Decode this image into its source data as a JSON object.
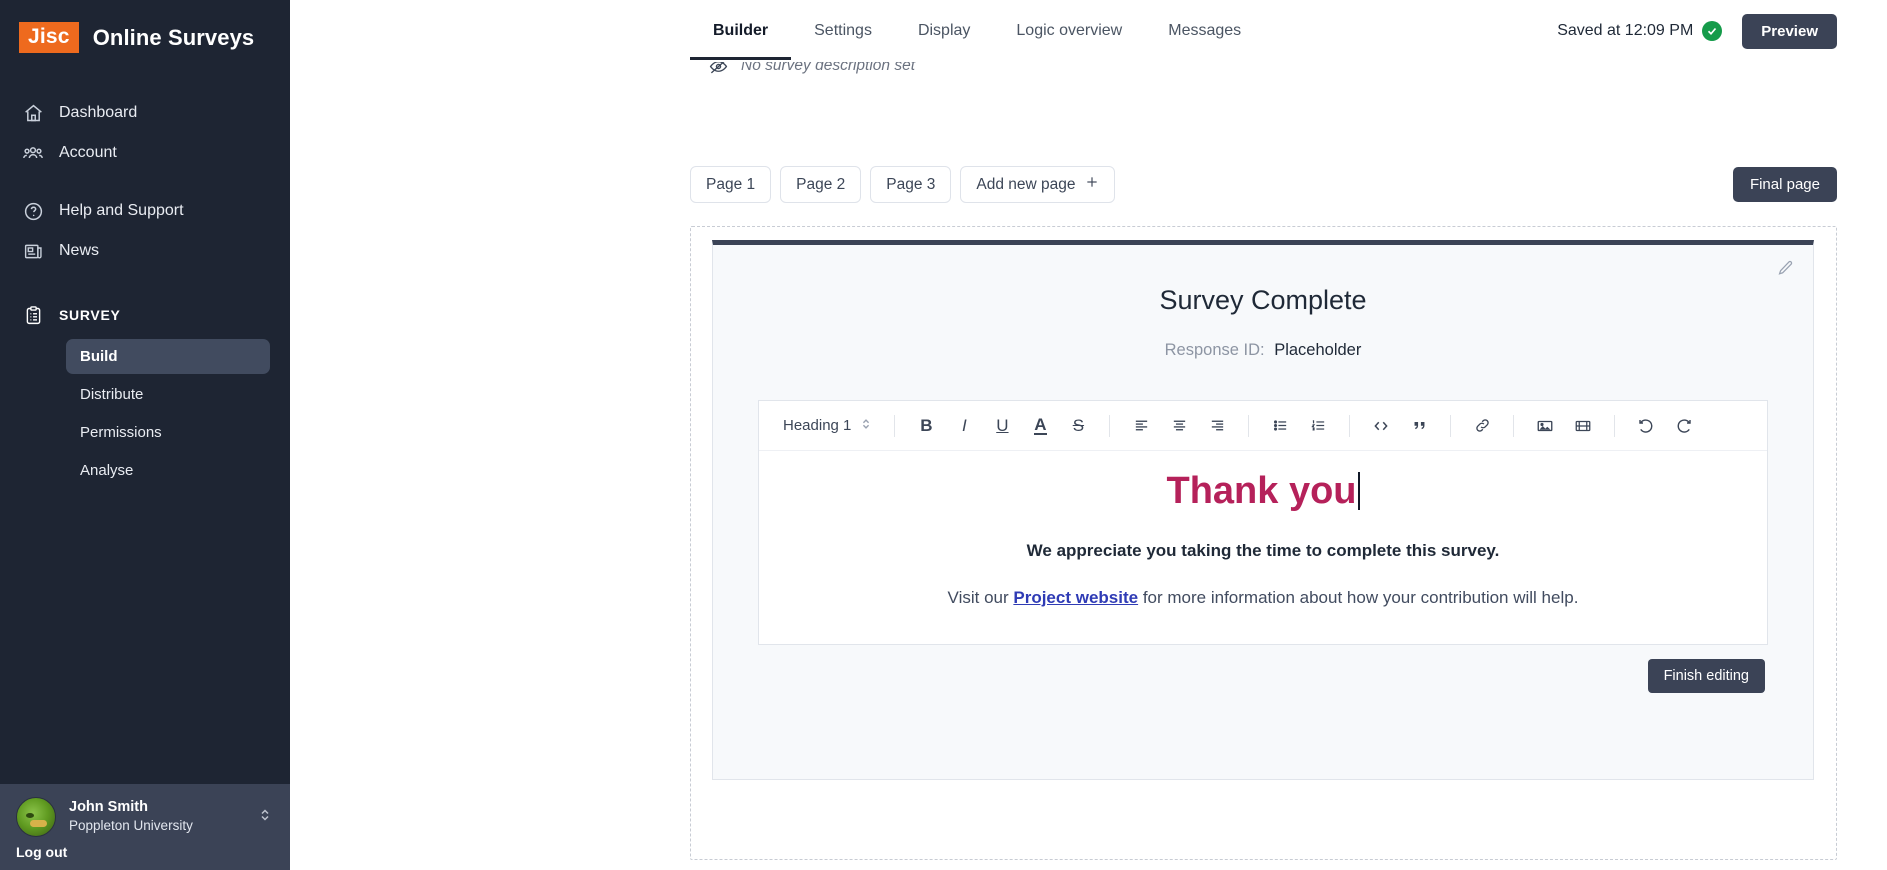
{
  "brand": {
    "logo_text": "Jisc",
    "name": "Online Surveys",
    "accent": "#ee6a1e"
  },
  "sidebar": {
    "items": [
      {
        "label": "Dashboard",
        "icon": "home-icon"
      },
      {
        "label": "Account",
        "icon": "users-icon"
      },
      {
        "label": "Help and Support",
        "icon": "question-circle-icon"
      },
      {
        "label": "News",
        "icon": "newspaper-icon"
      }
    ],
    "section": {
      "label": "SURVEY",
      "icon": "clipboard-icon"
    },
    "sub_items": [
      {
        "label": "Build",
        "active": true
      },
      {
        "label": "Distribute",
        "active": false
      },
      {
        "label": "Permissions",
        "active": false
      },
      {
        "label": "Analyse",
        "active": false
      }
    ],
    "footer": {
      "name": "John Smith",
      "org": "Poppleton University",
      "logout": "Log out"
    }
  },
  "topbar": {
    "tabs": [
      {
        "label": "Builder",
        "active": true
      },
      {
        "label": "Settings",
        "active": false
      },
      {
        "label": "Display",
        "active": false
      },
      {
        "label": "Logic overview",
        "active": false
      },
      {
        "label": "Messages",
        "active": false
      }
    ],
    "saved_text": "Saved at 12:09 PM",
    "saved_color": "#159b4a",
    "preview_label": "Preview"
  },
  "description_strip": {
    "text": "No survey description set",
    "icon": "eye-slash-icon"
  },
  "page_tabs": {
    "pages": [
      "Page 1",
      "Page 2",
      "Page 3"
    ],
    "add_label": "Add new page",
    "final_badge": "Final page"
  },
  "card": {
    "title": "Survey Complete",
    "response_label": "Response ID:",
    "response_value": "Placeholder",
    "edit_icon": "pencil-icon",
    "finish_label": "Finish editing"
  },
  "editor": {
    "style_select": "Heading 1",
    "tools": [
      "bold-icon",
      "italic-icon",
      "underline-icon",
      "text-color-icon",
      "strikethrough-icon",
      "align-left-icon",
      "align-center-icon",
      "align-right-icon",
      "bullet-list-icon",
      "numbered-list-icon",
      "code-icon",
      "blockquote-icon",
      "link-icon",
      "image-icon",
      "video-icon",
      "undo-icon",
      "redo-icon"
    ],
    "heading": "Thank you",
    "heading_color": "#b5215a",
    "subheading": "We appreciate you taking the time to complete this survey.",
    "paragraph_before": "Visit our ",
    "paragraph_link": "Project website",
    "paragraph_after": " for more information about how your contribution will help."
  }
}
